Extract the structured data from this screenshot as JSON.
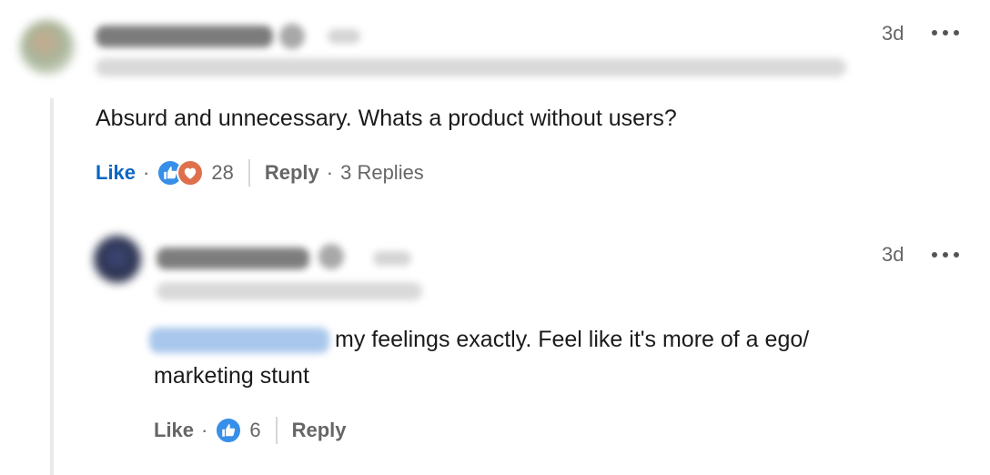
{
  "comment": {
    "time": "3d",
    "text": "Absurd and unnecessary. Whats a product without users?",
    "actions": {
      "like_label": "Like",
      "separator": "·",
      "reaction_count": "28",
      "reply_label": "Reply",
      "replies_label": "3 Replies"
    }
  },
  "reply": {
    "time": "3d",
    "text_line1": "my feelings exactly. Feel like it's more of a ego/",
    "text_line2": "marketing stunt",
    "actions": {
      "like_label": "Like",
      "separator": "·",
      "reaction_count": "6",
      "reply_label": "Reply"
    }
  },
  "icons": {
    "like": "like-reaction-icon",
    "love": "love-reaction-icon",
    "more": "more-options-icon",
    "verified": "verified-badge-icon"
  },
  "colors": {
    "accent": "#0a66c2",
    "like_reaction": "#378fe9",
    "love_reaction": "#df704d",
    "thread_line": "#eaeaea"
  }
}
